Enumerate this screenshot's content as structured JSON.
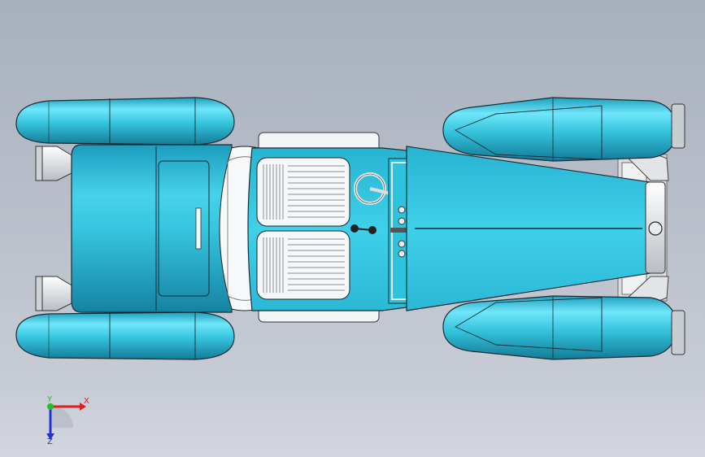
{
  "viewport": {
    "background_top": "#a7b0bd",
    "background_bottom": "#d3d6de"
  },
  "model": {
    "body_color": "#2bbfd6",
    "body_highlight": "#8ef0ff",
    "body_shadow": "#1487a5",
    "tire_color": "#34c3dc",
    "chrome_color": "#e9ecef",
    "edge_color": "#1b2a33"
  },
  "triad": {
    "x_label": "X",
    "y_label": "Y",
    "z_label": "Z",
    "x_color": "#e0201c",
    "y_color": "#1fbf2b",
    "z_color": "#2230d6"
  }
}
